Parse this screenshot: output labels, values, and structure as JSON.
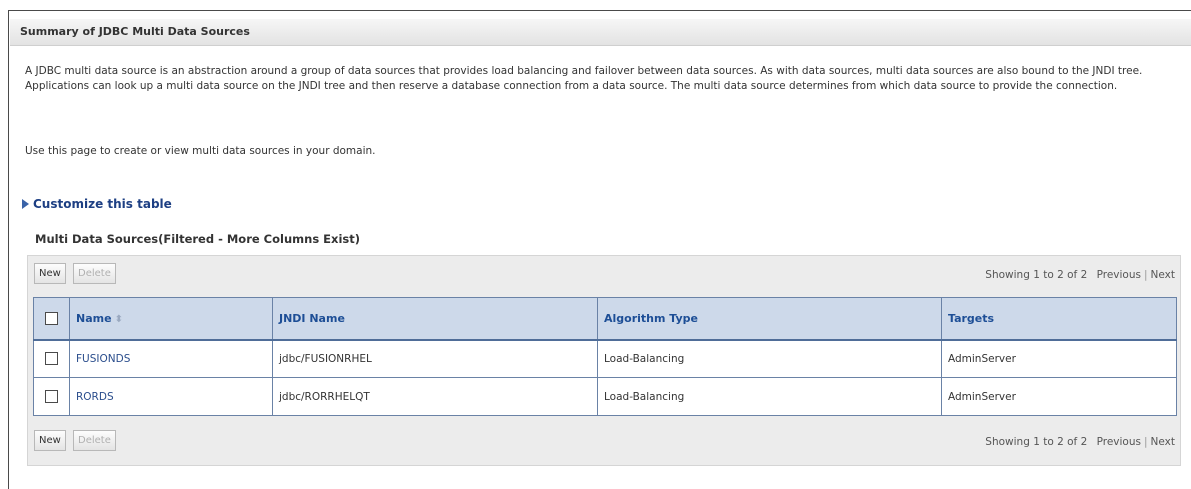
{
  "header": {
    "title": "Summary of JDBC Multi Data Sources"
  },
  "intro": {
    "paragraph": "A JDBC multi data source is an abstraction around a group of data sources that provides load balancing and failover between data sources. As with data sources, multi data sources are also bound to the JNDI tree. Applications can look up a multi data source on the JNDI tree and then reserve a database connection from a data source. The multi data source determines from which data source to provide the connection.",
    "usage": "Use this page to create or view multi data sources in your domain."
  },
  "customize": {
    "label": "Customize this table"
  },
  "table": {
    "title": "Multi Data Sources(Filtered - More Columns Exist)",
    "buttons": {
      "new": "New",
      "delete": "Delete"
    },
    "pager": {
      "showing": "Showing 1 to 2 of 2",
      "previous": "Previous",
      "separator": "|",
      "next": "Next"
    },
    "columns": [
      "Name",
      "JNDI Name",
      "Algorithm Type",
      "Targets"
    ],
    "rows": [
      {
        "name": "FUSIONDS",
        "jndi": "jdbc/FUSIONRHEL",
        "algorithm": "Load-Balancing",
        "targets": "AdminServer"
      },
      {
        "name": "RORDS",
        "jndi": "jdbc/RORRHELQT",
        "algorithm": "Load-Balancing",
        "targets": "AdminServer"
      }
    ]
  },
  "icons": {
    "sort": "sort-icon",
    "expand": "expand-triangle-icon",
    "checkbox": "checkbox-icon"
  },
  "colors": {
    "header_text": "#1d4e96",
    "link": "#2a4d8c",
    "table_header_bg": "#cdd9ea",
    "table_border": "#6a82a6"
  }
}
